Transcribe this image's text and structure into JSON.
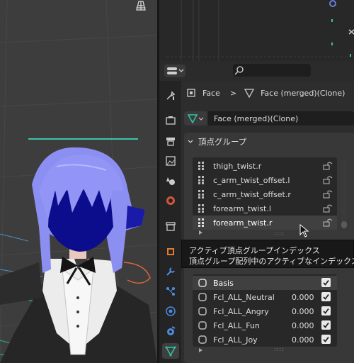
{
  "properties": {
    "breadcrumb": {
      "object": "Face",
      "separator": ">",
      "mesh": "Face (merged)(Clone)"
    },
    "mesh_datablock": "Face (merged)(Clone)",
    "vertex_groups_panel": {
      "title": "頂点グループ",
      "items": [
        {
          "label": "thigh_twist.r"
        },
        {
          "label": "c_arm_twist_offset.l"
        },
        {
          "label": "c_arm_twist_offset.r"
        },
        {
          "label": "forearm_twist.l"
        },
        {
          "label": "forearm_twist.r",
          "selected": true
        }
      ]
    },
    "tooltip": {
      "line1": "アクティブ頂点グループインデックス",
      "line2": "頂点グループ配列中のアクティブなインデックス"
    },
    "shape_keys": {
      "items": [
        {
          "label": "Basis",
          "value": "",
          "checked": true,
          "selected": true
        },
        {
          "label": "Fcl_ALL_Neutral",
          "value": "0.000",
          "checked": true
        },
        {
          "label": "Fcl_ALL_Angry",
          "value": "0.000",
          "checked": true
        },
        {
          "label": "Fcl_ALL_Fun",
          "value": "0.000",
          "checked": true
        },
        {
          "label": "Fcl_ALL_Joy",
          "value": "0.000",
          "checked": true
        }
      ]
    }
  },
  "colors": {
    "accent_green": "#30c5a5",
    "hair": "#8c8ff2",
    "face_selected": "#0c0d8c",
    "active_tab_orange": "#e27b30"
  }
}
